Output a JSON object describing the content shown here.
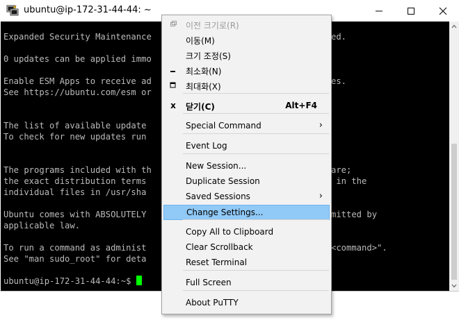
{
  "window": {
    "title": "ubuntu@ip-172-31-44-44: ~",
    "controls": {
      "minimize": "minimize",
      "maximize": "maximize",
      "close": "close"
    }
  },
  "terminal": {
    "lines": [
      "Expanded Security Maintenance",
      "",
      "0 updates can be applied immo",
      "",
      "Enable ESM Apps to receive ad",
      "See https://ubuntu.com/esm or",
      "",
      "",
      "The list of available update",
      "To check for new updates run",
      "",
      "",
      "The programs included with th",
      "the exact distribution terms",
      "individual files in /usr/sha",
      "",
      "Ubuntu comes with ABSOLUTELY",
      "applicable law.",
      "",
      "To run a command as administ",
      "See \"man sudo_root\" for deta",
      "",
      "ubuntu@ip-172-31-44-44:~$"
    ],
    "right_fragments": [
      {
        "row": 0,
        "text": "ed."
      },
      {
        "row": 4,
        "text": "es."
      },
      {
        "row": 12,
        "text": "are;"
      },
      {
        "row": 13,
        "text": " in the"
      },
      {
        "row": 16,
        "text": "mitted by"
      },
      {
        "row": 19,
        "text": "<command>\"."
      }
    ],
    "cursor_color": "#00ff00"
  },
  "context_menu": {
    "items": [
      {
        "name": "restore",
        "label": "이전 크기로(R)",
        "icon": "restore-icon",
        "disabled": true
      },
      {
        "name": "move",
        "label": "이동(M)"
      },
      {
        "name": "size",
        "label": "크기 조정(S)"
      },
      {
        "name": "minimize",
        "label": "최소화(N)",
        "icon": "minimize-glyph-icon"
      },
      {
        "name": "maximize",
        "label": "최대화(X)",
        "icon": "maximize-glyph-icon"
      },
      {
        "name": "close",
        "label": "닫기(C)",
        "icon": "close-icon",
        "shortcut": "Alt+F4",
        "bold": true
      },
      {
        "name": "special-command",
        "label": "Special Command",
        "submenu": true
      },
      {
        "name": "event-log",
        "label": "Event Log"
      },
      {
        "name": "new-session",
        "label": "New Session..."
      },
      {
        "name": "duplicate-session",
        "label": "Duplicate Session"
      },
      {
        "name": "saved-sessions",
        "label": "Saved Sessions",
        "submenu": true
      },
      {
        "name": "change-settings",
        "label": "Change Settings...",
        "highlight": true
      },
      {
        "name": "copy-all",
        "label": "Copy All to Clipboard"
      },
      {
        "name": "clear-scrollback",
        "label": "Clear Scrollback"
      },
      {
        "name": "reset-terminal",
        "label": "Reset Terminal"
      },
      {
        "name": "full-screen",
        "label": "Full Screen"
      },
      {
        "name": "about",
        "label": "About PuTTY"
      }
    ],
    "glyphs": {
      "close": "x",
      "submenu_arrow": "›"
    }
  },
  "colors": {
    "highlight": "#91c9f7",
    "menu_bg": "#f2f2f2",
    "terminal_bg": "#000000",
    "terminal_fg": "#bbbbbb"
  }
}
